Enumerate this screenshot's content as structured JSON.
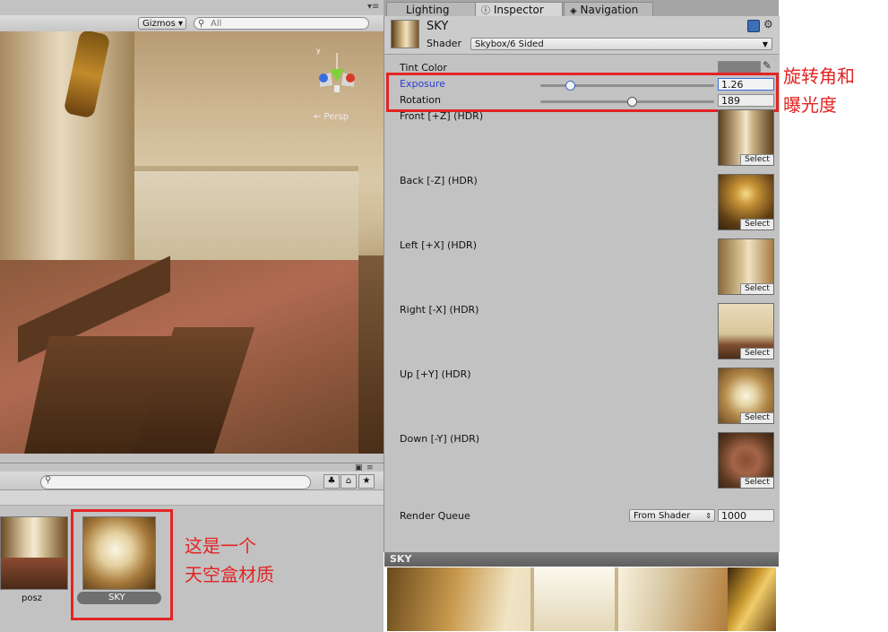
{
  "scene": {
    "gizmos_label": "Gizmos ▾",
    "search_placeholder": "All",
    "persp_label": "← Persp"
  },
  "project": {
    "assets": [
      {
        "label": "posz"
      },
      {
        "label": "SKY"
      }
    ]
  },
  "tabs": [
    {
      "label": "Lighting"
    },
    {
      "label": "Inspector"
    },
    {
      "label": "Navigation"
    }
  ],
  "inspector": {
    "material_name": "SKY",
    "shader_label": "Shader",
    "shader_value": "Skybox/6 Sided",
    "tint_label": "Tint Color",
    "tint_color": "#808080",
    "exposure_label": "Exposure",
    "exposure_value": "1.26",
    "exposure_fraction": 0.17,
    "rotation_label": "Rotation",
    "rotation_value": "189",
    "rotation_fraction": 0.525,
    "faces": [
      {
        "label": "Front [+Z]   (HDR)",
        "select": "Select"
      },
      {
        "label": "Back [-Z]   (HDR)",
        "select": "Select"
      },
      {
        "label": "Left [+X]   (HDR)",
        "select": "Select"
      },
      {
        "label": "Right [-X]   (HDR)",
        "select": "Select"
      },
      {
        "label": "Up [+Y]   (HDR)",
        "select": "Select"
      },
      {
        "label": "Down [-Y]   (HDR)",
        "select": "Select"
      }
    ],
    "render_queue_label": "Render Queue",
    "render_queue_mode": "From Shader",
    "render_queue_value": "1000",
    "preview_title": "SKY"
  },
  "annotations": {
    "inspector_note_line1": "旋转角和",
    "inspector_note_line2": "曝光度",
    "project_note_line1": "这是一个",
    "project_note_line2": "天空盒材质"
  },
  "colors": {
    "annotation_red": "#e32424",
    "exposure_label_blue": "#2a3fd0"
  }
}
